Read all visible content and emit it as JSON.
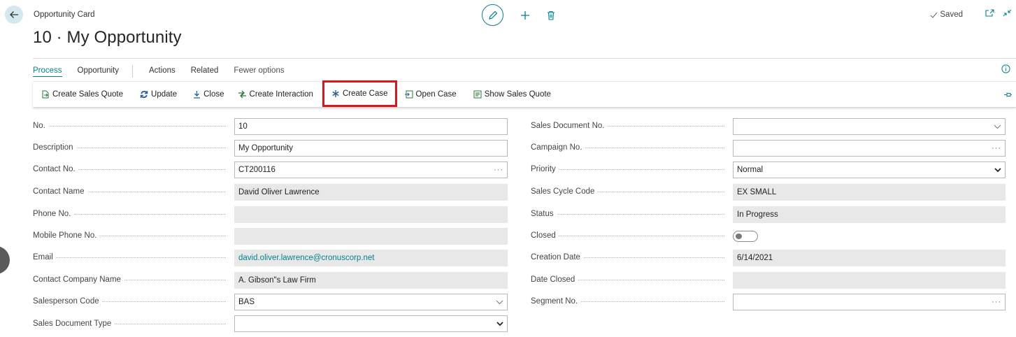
{
  "header": {
    "page_kind": "Opportunity Card",
    "title": "10 · My Opportunity",
    "status": "Saved"
  },
  "tabs": [
    {
      "label": "Process",
      "active": true
    },
    {
      "label": "Opportunity"
    },
    {
      "label": "Actions"
    },
    {
      "label": "Related"
    },
    {
      "label": "Fewer options"
    }
  ],
  "actions": [
    {
      "label": "Create Sales Quote",
      "icon": "create-sales-quote-icon"
    },
    {
      "label": "Update",
      "icon": "refresh-icon"
    },
    {
      "label": "Close",
      "icon": "download-arrow-icon"
    },
    {
      "label": "Create Interaction",
      "icon": "interaction-icon"
    },
    {
      "label": "Create Case",
      "icon": "asterisk-icon",
      "highlighted": true
    },
    {
      "label": "Open Case",
      "icon": "open-case-icon"
    },
    {
      "label": "Show Sales Quote",
      "icon": "sales-quote-icon"
    }
  ],
  "left_fields": [
    {
      "label": "No.",
      "value": "10",
      "kind": "text"
    },
    {
      "label": "Description",
      "value": "My Opportunity",
      "kind": "text"
    },
    {
      "label": "Contact No.",
      "value": "CT200116",
      "kind": "lookup"
    },
    {
      "label": "Contact Name",
      "value": "David Oliver Lawrence",
      "kind": "readonly"
    },
    {
      "label": "Phone No.",
      "value": "",
      "kind": "readonly"
    },
    {
      "label": "Mobile Phone No.",
      "value": "",
      "kind": "readonly"
    },
    {
      "label": "Email",
      "value": "david.oliver.lawrence@cronuscorp.net",
      "kind": "readonly-link"
    },
    {
      "label": "Contact Company Name",
      "value": "A. Gibson\"s Law Firm",
      "kind": "readonly"
    },
    {
      "label": "Salesperson Code",
      "value": "BAS",
      "kind": "dropdown-light"
    },
    {
      "label": "Sales Document Type",
      "value": "",
      "kind": "select"
    }
  ],
  "right_fields": [
    {
      "label": "Sales Document No.",
      "value": "",
      "kind": "dropdown-light"
    },
    {
      "label": "Campaign No.",
      "value": "",
      "kind": "lookup"
    },
    {
      "label": "Priority",
      "value": "Normal",
      "kind": "select"
    },
    {
      "label": "Sales Cycle Code",
      "value": "EX SMALL",
      "kind": "readonly"
    },
    {
      "label": "Status",
      "value": "In Progress",
      "kind": "readonly"
    },
    {
      "label": "Closed",
      "value": "",
      "kind": "toggle"
    },
    {
      "label": "Creation Date",
      "value": "6/14/2021",
      "kind": "readonly"
    },
    {
      "label": "Date Closed",
      "value": "",
      "kind": "readonly"
    },
    {
      "label": "Segment No.",
      "value": "",
      "kind": "lookup"
    }
  ],
  "symbols": {
    "lookup": "···"
  },
  "colors": {
    "accent": "#00838f",
    "highlight_border": "#e0121a",
    "readonly_bg": "#e8e8e8"
  }
}
